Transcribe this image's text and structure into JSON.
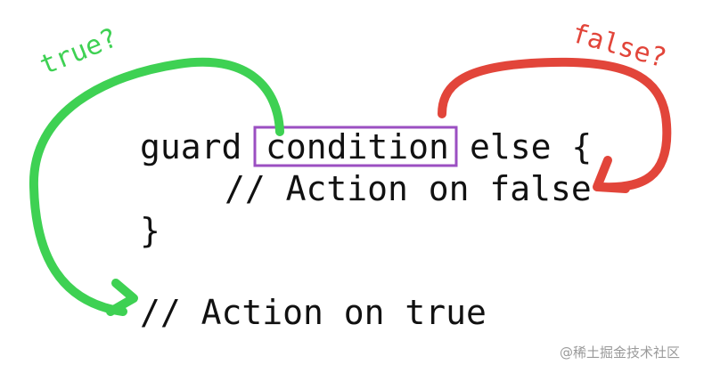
{
  "code": {
    "guard_keyword": "guard",
    "condition": "condition",
    "else_brace": "else {",
    "false_action": "// Action on false",
    "closing_brace": "}",
    "true_action": "// Action on true"
  },
  "annotations": {
    "true_label": "true?",
    "false_label": "false?"
  },
  "watermark": "@稀土掘金技术社区",
  "colors": {
    "true_arrow": "#3ed153",
    "false_arrow": "#e2453a",
    "condition_box": "#9b4fc2",
    "code_text": "#111111"
  }
}
